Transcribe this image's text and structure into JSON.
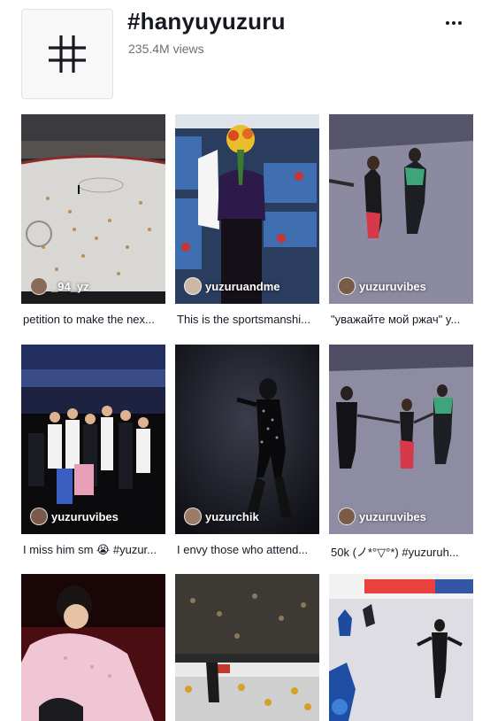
{
  "header": {
    "tag_icon": "hashtag-icon",
    "title": "#hanyuyuzuru",
    "views": "235.4M views",
    "more_icon": "more-horizontal-icon"
  },
  "videos": [
    {
      "author": "_94_yz",
      "caption": "petition to make the nex..."
    },
    {
      "author": "yuzuruandme",
      "caption": "This is the sportsmanshi..."
    },
    {
      "author": "yuzuruvibes",
      "caption": "\"уважайте мой ржач\" y..."
    },
    {
      "author": "yuzuruvibes",
      "caption": "I miss him sm 😭 #yuzur..."
    },
    {
      "author": "yuzurchik",
      "caption": "I envy those who attend..."
    },
    {
      "author": "yuzuruvibes",
      "caption": "50k (ノ*°▽°*) #yuzuruh..."
    },
    {
      "author": "",
      "caption": ""
    },
    {
      "author": "",
      "caption": ""
    },
    {
      "author": "",
      "caption": ""
    }
  ],
  "colors": {
    "text": "#161823",
    "secondary": "#6e6f76",
    "border": "#e3e3e4"
  }
}
